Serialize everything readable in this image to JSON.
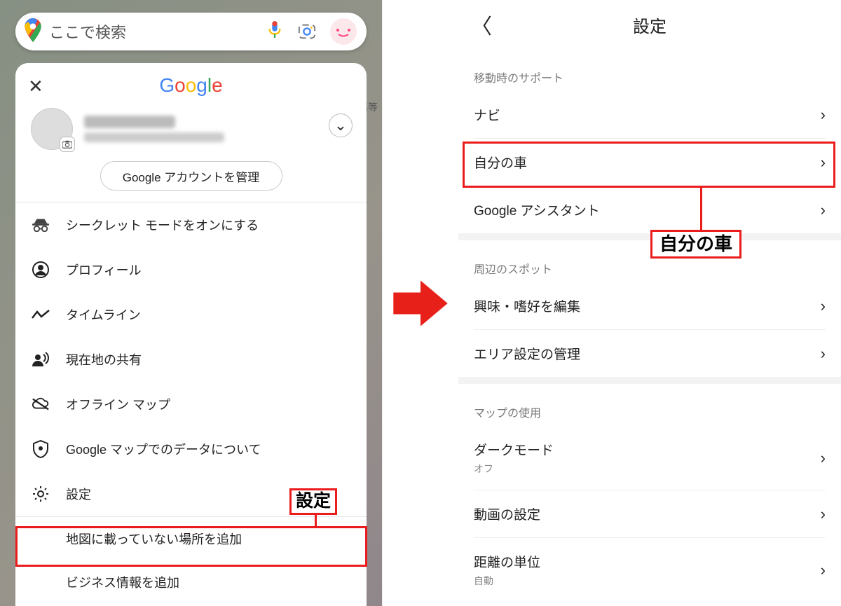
{
  "left": {
    "search_placeholder": "ここで検索",
    "google_logo": "Google",
    "manage_account": "Google アカウントを管理",
    "menu": {
      "incognito": "シークレット モードをオンにする",
      "profile": "プロフィール",
      "timeline": "タイムライン",
      "share_location": "現在地の共有",
      "offline_maps": "オフライン マップ",
      "your_data": "Google マップでのデータについて",
      "settings": "設定",
      "add_missing": "地図に載っていない場所を追加",
      "add_business": "ビジネス情報を追加"
    },
    "annotation_settings": "設定",
    "map_label_1": "早稲\n高等"
  },
  "right": {
    "title": "設定",
    "sections": {
      "support": {
        "header": "移動時のサポート",
        "nav": "ナビ",
        "my_car": "自分の車",
        "assistant": "Google アシスタント"
      },
      "spots": {
        "header": "周辺のスポット",
        "interests": "興味・嗜好を編集",
        "area": "エリア設定の管理"
      },
      "map_use": {
        "header": "マップの使用",
        "dark": "ダークモード",
        "dark_sub": "オフ",
        "video": "動画の設定",
        "distance": "距離の単位",
        "distance_sub": "自動"
      }
    },
    "annotation_mycar": "自分の車"
  }
}
